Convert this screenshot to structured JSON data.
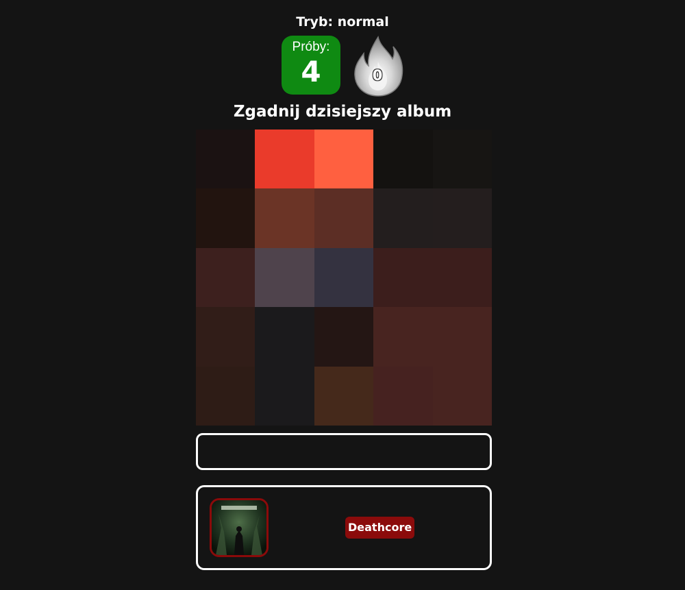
{
  "header": {
    "mode_text": "Tryb: normal"
  },
  "stats": {
    "tries_label": "Próby:",
    "tries_count": "4",
    "streak_count": "0"
  },
  "title": "Zgadnij dzisiejszy album",
  "cover_tiles": [
    "#1b1212",
    "#ea3b2b",
    "#ff6040",
    "#141210",
    "#171513",
    "#22140f",
    "#6b3426",
    "#5c2e25",
    "#231e1e",
    "#241e1e",
    "#3d201e",
    "#4f434c",
    "#343240",
    "#3c1e1c",
    "#3c1e1c",
    "#311d18",
    "#1b1a1c",
    "#241614",
    "#482420",
    "#482420",
    "#2e1c16",
    "#1b1a1c",
    "#45291b",
    "#462220",
    "#482420"
  ],
  "guess_input": {
    "value": "",
    "placeholder": ""
  },
  "hint": {
    "genre": "Deathcore",
    "genre_color": "#8b0b0b"
  },
  "colors": {
    "background": "#141414",
    "tries_bg": "#0f8a12",
    "thumb_border": "#8b0a0a"
  }
}
